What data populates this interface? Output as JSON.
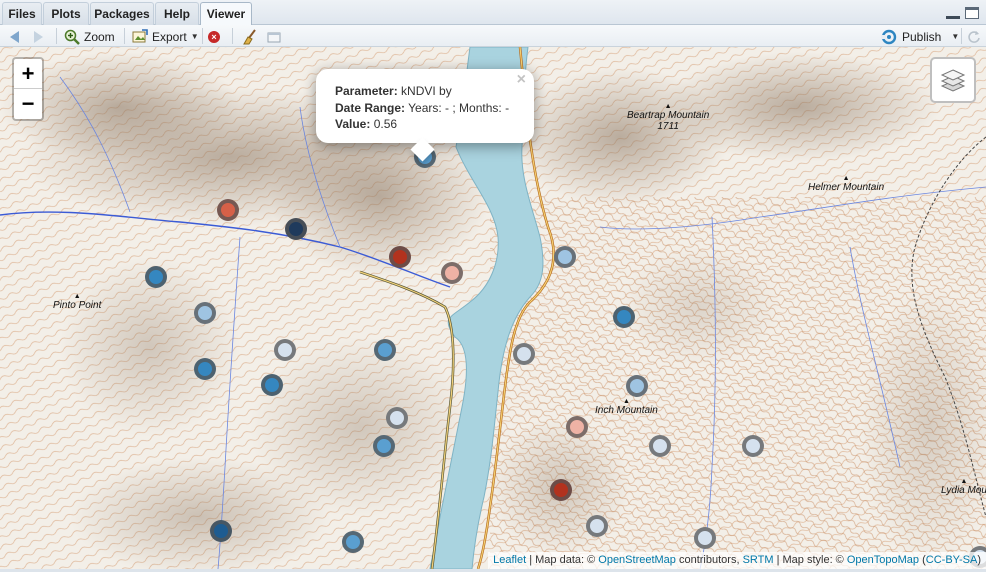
{
  "tabs": [
    {
      "label": "Files",
      "active": false
    },
    {
      "label": "Plots",
      "active": false
    },
    {
      "label": "Packages",
      "active": false
    },
    {
      "label": "Help",
      "active": false
    },
    {
      "label": "Viewer",
      "active": true
    }
  ],
  "toolbar": {
    "zoom_label": "Zoom",
    "export_label": "Export",
    "publish_label": "Publish"
  },
  "map": {
    "zoom_in_label": "+",
    "zoom_out_label": "−",
    "places": [
      {
        "name": "Beartrap Mountain",
        "elevation": "1711"
      },
      {
        "name": "Helmer Mountain"
      },
      {
        "name": "Pinto Point"
      },
      {
        "name": "Inch Mountain"
      },
      {
        "name": "Lydia Mou"
      }
    ],
    "popup": {
      "param_label": "Parameter:",
      "param_value": "kNDVI by",
      "date_label": "Date Range:",
      "date_value": "Years: - ; Months: -",
      "value_label": "Value:",
      "value": "0.56",
      "close": "×"
    },
    "attribution": {
      "leaflet": "Leaflet",
      "sep": " | Map data: © ",
      "osm": "OpenStreetMap",
      "contributors": " contributors, ",
      "srtm": "SRTM",
      "style": " | Map style: © ",
      "otm": "OpenTopoMap",
      "license": "CC-BY-SA"
    }
  },
  "colors": {
    "water": "#a9d3df",
    "dark_red": "#b2321e",
    "red": "#d66048",
    "light_red": "#eeb2a5",
    "very_light_blue": "#d5e1ee",
    "light_blue": "#9fc4e2",
    "mid_blue": "#5a9fd0",
    "blue": "#3587c0",
    "dark_blue": "#1e5c91",
    "navy": "#1f3a5c"
  },
  "markers": [
    {
      "color": "mid_blue"
    },
    {
      "color": "red"
    },
    {
      "color": "navy"
    },
    {
      "color": "dark_red"
    },
    {
      "color": "light_red"
    },
    {
      "color": "light_blue"
    },
    {
      "color": "blue"
    },
    {
      "color": "light_blue"
    },
    {
      "color": "blue"
    },
    {
      "color": "very_light_blue"
    },
    {
      "color": "mid_blue"
    },
    {
      "color": "blue"
    },
    {
      "color": "very_light_blue"
    },
    {
      "color": "blue"
    },
    {
      "color": "dark_blue"
    },
    {
      "color": "mid_blue"
    },
    {
      "color": "light_blue"
    },
    {
      "color": "very_light_blue"
    },
    {
      "color": "mid_blue"
    },
    {
      "color": "very_light_blue"
    },
    {
      "color": "light_red"
    },
    {
      "color": "very_light_blue"
    },
    {
      "color": "very_light_blue"
    },
    {
      "color": "dark_red"
    },
    {
      "color": "very_light_blue"
    },
    {
      "color": "very_light_blue"
    }
  ]
}
